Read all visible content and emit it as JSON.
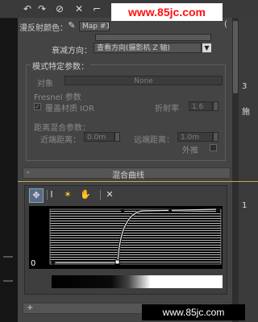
{
  "watermarks": {
    "top": "www.85jc.com",
    "bottom": "www.85jc.com"
  },
  "toolbar": {
    "icons": [
      "undo-icon",
      "redo-icon",
      "reset-icon",
      "close-icon"
    ]
  },
  "top_row": {
    "label": "漫反射颜色：",
    "map_field": "Map #1",
    "map_suffix": "("
  },
  "falloff": {
    "label": "衰减方向：",
    "value": "查看方向(摄影机 Z 轴)"
  },
  "mode_section": {
    "title": "模式特定参数：",
    "object_label": "对象",
    "object_value": "None",
    "fresnel_title": "Fresnel 参数",
    "override_label": "覆盖材质 IOR",
    "override_checked": true,
    "ior_label": "折射率",
    "ior_value": "1.6"
  },
  "distance_section": {
    "title": "距离混合参数：",
    "near_label": "近端距离：",
    "near_value": "0.0m",
    "far_label": "远端距离：",
    "far_value": "1.0m",
    "extrapolate_label": "外推"
  },
  "rollout": {
    "collapse_glyph": "-",
    "title": "混合曲线"
  },
  "curve": {
    "axis_label": "0"
  },
  "bottom_bar": {
    "glyph": "+"
  },
  "right_strip": {
    "labels": [
      "3",
      "施",
      "1"
    ]
  },
  "colors": {
    "accent_line": "#c8a84a",
    "watermark_red": "#ff1010"
  }
}
